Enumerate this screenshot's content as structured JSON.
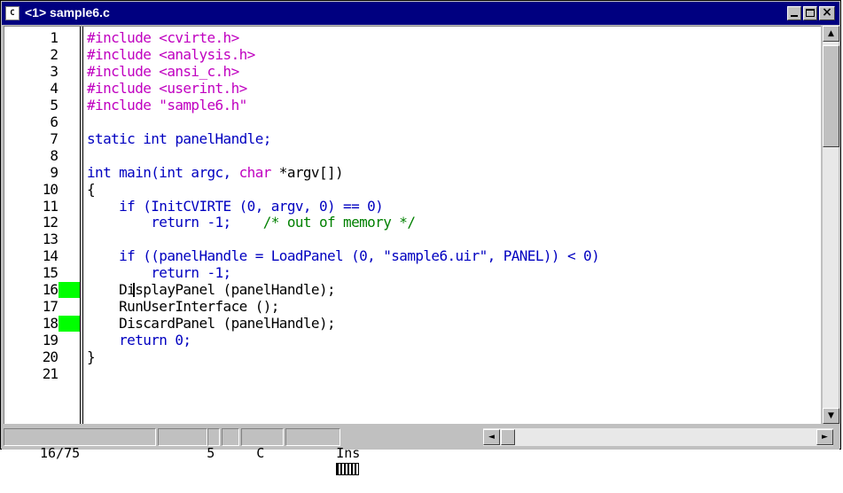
{
  "window": {
    "icon_label": "C",
    "title": "<1> sample6.c"
  },
  "editor": {
    "lines": [
      {
        "num": "1",
        "marker": false,
        "tokens": [
          {
            "t": "#include <cvirte.h>",
            "c": "pre"
          }
        ]
      },
      {
        "num": "2",
        "marker": false,
        "tokens": [
          {
            "t": "#include <analysis.h>",
            "c": "pre"
          }
        ]
      },
      {
        "num": "3",
        "marker": false,
        "tokens": [
          {
            "t": "#include <ansi_c.h>",
            "c": "pre"
          }
        ]
      },
      {
        "num": "4",
        "marker": false,
        "tokens": [
          {
            "t": "#include <userint.h>",
            "c": "pre"
          }
        ]
      },
      {
        "num": "5",
        "marker": false,
        "tokens": [
          {
            "t": "#include \"sample6.h\"",
            "c": "pre"
          }
        ]
      },
      {
        "num": "6",
        "marker": false,
        "tokens": []
      },
      {
        "num": "7",
        "marker": false,
        "tokens": [
          {
            "t": "static int panelHandle;",
            "c": "kw"
          }
        ]
      },
      {
        "num": "8",
        "marker": false,
        "tokens": []
      },
      {
        "num": "9",
        "marker": false,
        "tokens": [
          {
            "t": "int main(int argc, ",
            "c": "kw"
          },
          {
            "t": "char",
            "c": "pre"
          },
          {
            "t": " *argv[])",
            "c": "plain"
          }
        ]
      },
      {
        "num": "10",
        "marker": false,
        "tokens": [
          {
            "t": "{",
            "c": "plain"
          }
        ]
      },
      {
        "num": "11",
        "marker": false,
        "tokens": [
          {
            "t": "    if (InitCVIRTE (0, argv, 0) == 0)",
            "c": "kw"
          }
        ]
      },
      {
        "num": "12",
        "marker": false,
        "tokens": [
          {
            "t": "        return -1;",
            "c": "kw"
          },
          {
            "t": "    /* out of memory */",
            "c": "cmt"
          }
        ]
      },
      {
        "num": "13",
        "marker": false,
        "tokens": []
      },
      {
        "num": "14",
        "marker": false,
        "tokens": [
          {
            "t": "    if ((panelHandle = LoadPanel (0, \"sample6.uir\", PANEL)) < 0)",
            "c": "kw"
          }
        ]
      },
      {
        "num": "15",
        "marker": false,
        "tokens": [
          {
            "t": "        return -1;",
            "c": "kw"
          }
        ]
      },
      {
        "num": "16",
        "marker": true,
        "tokens": [
          {
            "t": "    DisplayPanel (panelHandle);",
            "c": "plain"
          }
        ]
      },
      {
        "num": "17",
        "marker": false,
        "tokens": [
          {
            "t": "    RunUserInterface ();",
            "c": "plain"
          }
        ]
      },
      {
        "num": "18",
        "marker": true,
        "tokens": [
          {
            "t": "    DiscardPanel (panelHandle);",
            "c": "plain"
          }
        ]
      },
      {
        "num": "19",
        "marker": false,
        "tokens": [
          {
            "t": "    return 0;",
            "c": "kw"
          }
        ]
      },
      {
        "num": "20",
        "marker": false,
        "tokens": [
          {
            "t": "}",
            "c": "plain"
          }
        ]
      },
      {
        "num": "21",
        "marker": false,
        "tokens": []
      }
    ]
  },
  "statusbar": {
    "position": "16/75",
    "column": "5",
    "column_suffix": "C",
    "mode": "Ins"
  },
  "scroll": {
    "up_arrow": "▲",
    "down_arrow": "▼",
    "left_arrow": "◄",
    "right_arrow": "►"
  },
  "colors": {
    "titlebar": "#000080",
    "preprocessor": "#c000c0",
    "keyword": "#0000c0",
    "comment": "#008000",
    "breakpoint_marker": "#00ff00"
  }
}
